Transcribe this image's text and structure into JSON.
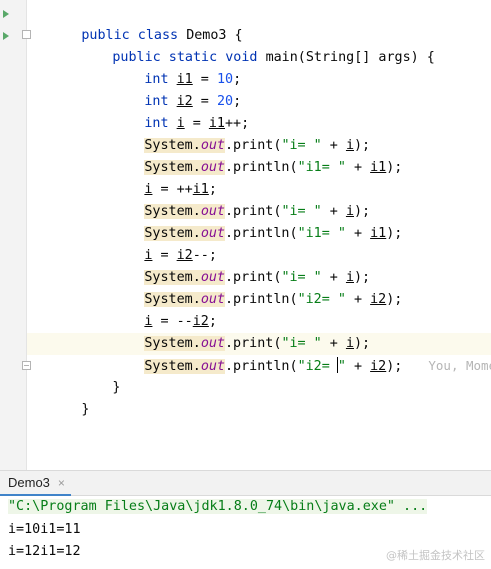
{
  "editor": {
    "lines": [
      {
        "kw": "public class ",
        "cls": "Demo3 {"
      },
      {
        "kw": "public static void ",
        "cls": "main(String[] args) {"
      },
      {
        "kw": "int ",
        "var": "i1",
        "rest": " = ",
        "num": "10",
        "end": ";"
      },
      {
        "kw": "int ",
        "var": "i2",
        "rest": " = ",
        "num": "20",
        "end": ";"
      },
      {
        "kw": "int ",
        "var": "i",
        "rest": " = ",
        "var2": "i1",
        "end": "++;"
      },
      {
        "sys": "System.",
        "out": "out",
        "m": ".print(",
        "str": "\"i= \"",
        "plus": " + ",
        "v": "i",
        "end": ");"
      },
      {
        "sys": "System.",
        "out": "out",
        "m": ".println(",
        "str": "\"i1= \"",
        "plus": " + ",
        "v": "i1",
        "end": ");"
      },
      {
        "var": "i",
        "rest": " = ++",
        "var2": "i1",
        "end": ";"
      },
      {
        "sys": "System.",
        "out": "out",
        "m": ".print(",
        "str": "\"i= \"",
        "plus": " + ",
        "v": "i",
        "end": ");"
      },
      {
        "sys": "System.",
        "out": "out",
        "m": ".println(",
        "str": "\"i1= \"",
        "plus": " + ",
        "v": "i1",
        "end": ");"
      },
      {
        "var": "i",
        "rest": " = ",
        "var2": "i2",
        "end": "--;"
      },
      {
        "sys": "System.",
        "out": "out",
        "m": ".print(",
        "str": "\"i= \"",
        "plus": " + ",
        "v": "i",
        "end": ");"
      },
      {
        "sys": "System.",
        "out": "out",
        "m": ".println(",
        "str": "\"i2= \"",
        "plus": " + ",
        "v": "i2",
        "end": ");"
      },
      {
        "var": "i",
        "rest": " = --",
        "var2": "i2",
        "end": ";"
      },
      {
        "sys": "System.",
        "out": "out",
        "m": ".print(",
        "str": "\"i= \"",
        "plus": " + ",
        "v": "i",
        "end": ");"
      },
      {
        "sys": "System.",
        "out": "out",
        "m": ".println(",
        "str1": "\"i2= ",
        "str2": "\"",
        "plus": " + ",
        "v": "i2",
        "end": ");",
        "hint": "You, Moments ago"
      },
      {
        "close": "}"
      },
      {
        "close": "}"
      }
    ]
  },
  "run_panel": {
    "tab_label": "Demo3",
    "close_icon": "×",
    "command": "\"C:\\Program Files\\Java\\jdk1.8.0_74\\bin\\java.exe\" ...",
    "output": [
      "i=10i1=11",
      "i=12i1=12"
    ]
  },
  "watermark": "@稀土掘金技术社区",
  "colors": {
    "keyword": "#0033b3",
    "number": "#1750eb",
    "string": "#067d17",
    "static_field": "#871094",
    "run_arrow": "#59a869",
    "current_line": "#fcfaed"
  }
}
